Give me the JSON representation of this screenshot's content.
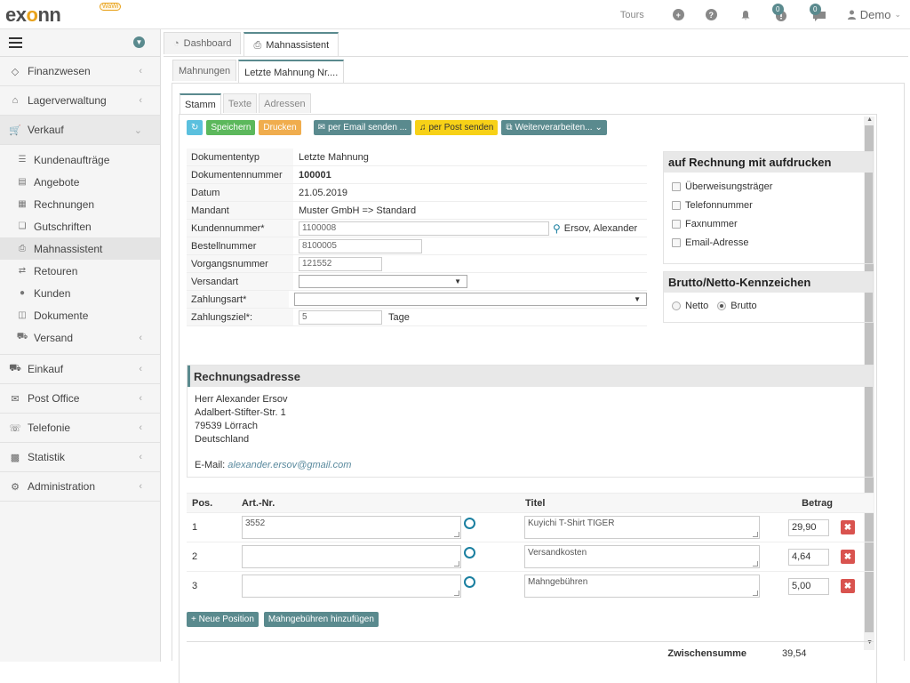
{
  "app": {
    "logo_text": "exonn",
    "logo_badge": "WaWi"
  },
  "topbar": {
    "tours": "Tours",
    "badge1": "0",
    "badge2": "0",
    "user": "Demo"
  },
  "sidebar": {
    "items": [
      {
        "label": "Finanzwesen",
        "icon": "diamond-icon"
      },
      {
        "label": "Lagerverwaltung",
        "icon": "warehouse-icon"
      },
      {
        "label": "Verkauf",
        "icon": "cart-icon"
      }
    ],
    "sub": [
      {
        "label": "Kundenaufträge",
        "icon": "stack-icon"
      },
      {
        "label": "Angebote",
        "icon": "document-icon"
      },
      {
        "label": "Rechnungen",
        "icon": "list-icon"
      },
      {
        "label": "Gutschriften",
        "icon": "tag-icon"
      },
      {
        "label": "Mahnassistent",
        "icon": "print-icon"
      },
      {
        "label": "Retouren",
        "icon": "return-icon"
      },
      {
        "label": "Kunden",
        "icon": "user-icon"
      },
      {
        "label": "Dokumente",
        "icon": "database-icon"
      },
      {
        "label": "Versand",
        "icon": "truck-icon"
      }
    ],
    "items2": [
      {
        "label": "Einkauf",
        "icon": "truck-icon"
      },
      {
        "label": "Post Office",
        "icon": "envelope-icon"
      },
      {
        "label": "Telefonie",
        "icon": "headset-icon"
      },
      {
        "label": "Statistik",
        "icon": "chart-icon"
      },
      {
        "label": "Administration",
        "icon": "gears-icon"
      }
    ]
  },
  "tabs": {
    "dashboard": "Dashboard",
    "mahnassistent": "Mahnassistent"
  },
  "subtabs": {
    "mahnungen": "Mahnungen",
    "letzte": "Letzte Mahnung Nr...."
  },
  "innertabs": {
    "stamm": "Stamm",
    "texte": "Texte",
    "adressen": "Adressen"
  },
  "toolbar": {
    "speichern": "Speichern",
    "drucken": "Drucken",
    "email": "per Email senden ...",
    "post": "per Post senden",
    "weiter": "Weiterverarbeiten..."
  },
  "form": {
    "dokumententyp_l": "Dokumententyp",
    "dokumententyp": "Letzte Mahnung",
    "dokumentennummer_l": "Dokumentennummer",
    "dokumentennummer": "100001",
    "datum_l": "Datum",
    "datum": "21.05.2019",
    "mandant_l": "Mandant",
    "mandant": "Muster GmbH => Standard",
    "kundennummer_l": "Kundennummer*",
    "kundennummer": "1100008",
    "kunde_name": "Ersov, Alexander",
    "bestellnummer_l": "Bestellnummer",
    "bestellnummer": "8100005",
    "vorgangsnummer_l": "Vorgangsnummer",
    "vorgangsnummer": "121552",
    "versandart_l": "Versandart",
    "zahlungsart_l": "Zahlungsart*",
    "zahlungsziel_l": "Zahlungsziel*:",
    "zahlungsziel": "5",
    "tage": "Tage"
  },
  "print_box": {
    "title": "auf Rechnung mit aufdrucken",
    "options": [
      "Überweisungsträger",
      "Telefonnummer",
      "Faxnummer",
      "Email-Adresse"
    ]
  },
  "brutto_box": {
    "title": "Brutto/Netto-Kennzeichen",
    "netto": "Netto",
    "brutto": "Brutto",
    "selected": "Brutto"
  },
  "address": {
    "title": "Rechnungsadresse",
    "lines": [
      "Herr Alexander Ersov",
      "Adalbert-Stifter-Str. 1",
      "79539 Lörrach",
      "Deutschland"
    ],
    "email_label": "E-Mail:",
    "email": "alexander.ersov@gmail.com"
  },
  "positions": {
    "headers": {
      "pos": "Pos.",
      "art": "Art.-Nr.",
      "titel": "Titel",
      "betrag": "Betrag"
    },
    "rows": [
      {
        "pos": "1",
        "art": "3552",
        "titel": "Kuyichi T-Shirt TIGER",
        "betrag": "29,90"
      },
      {
        "pos": "2",
        "art": "",
        "titel": "Versandkosten",
        "betrag": "4,64"
      },
      {
        "pos": "3",
        "art": "",
        "titel": "Mahngebühren",
        "betrag": "5,00"
      }
    ]
  },
  "actions": {
    "neue_position": "+ Neue Position",
    "mahngebuehren": "Mahngebühren hinzufügen"
  },
  "summary": {
    "label": "Zwischensumme",
    "value": "39,54"
  }
}
